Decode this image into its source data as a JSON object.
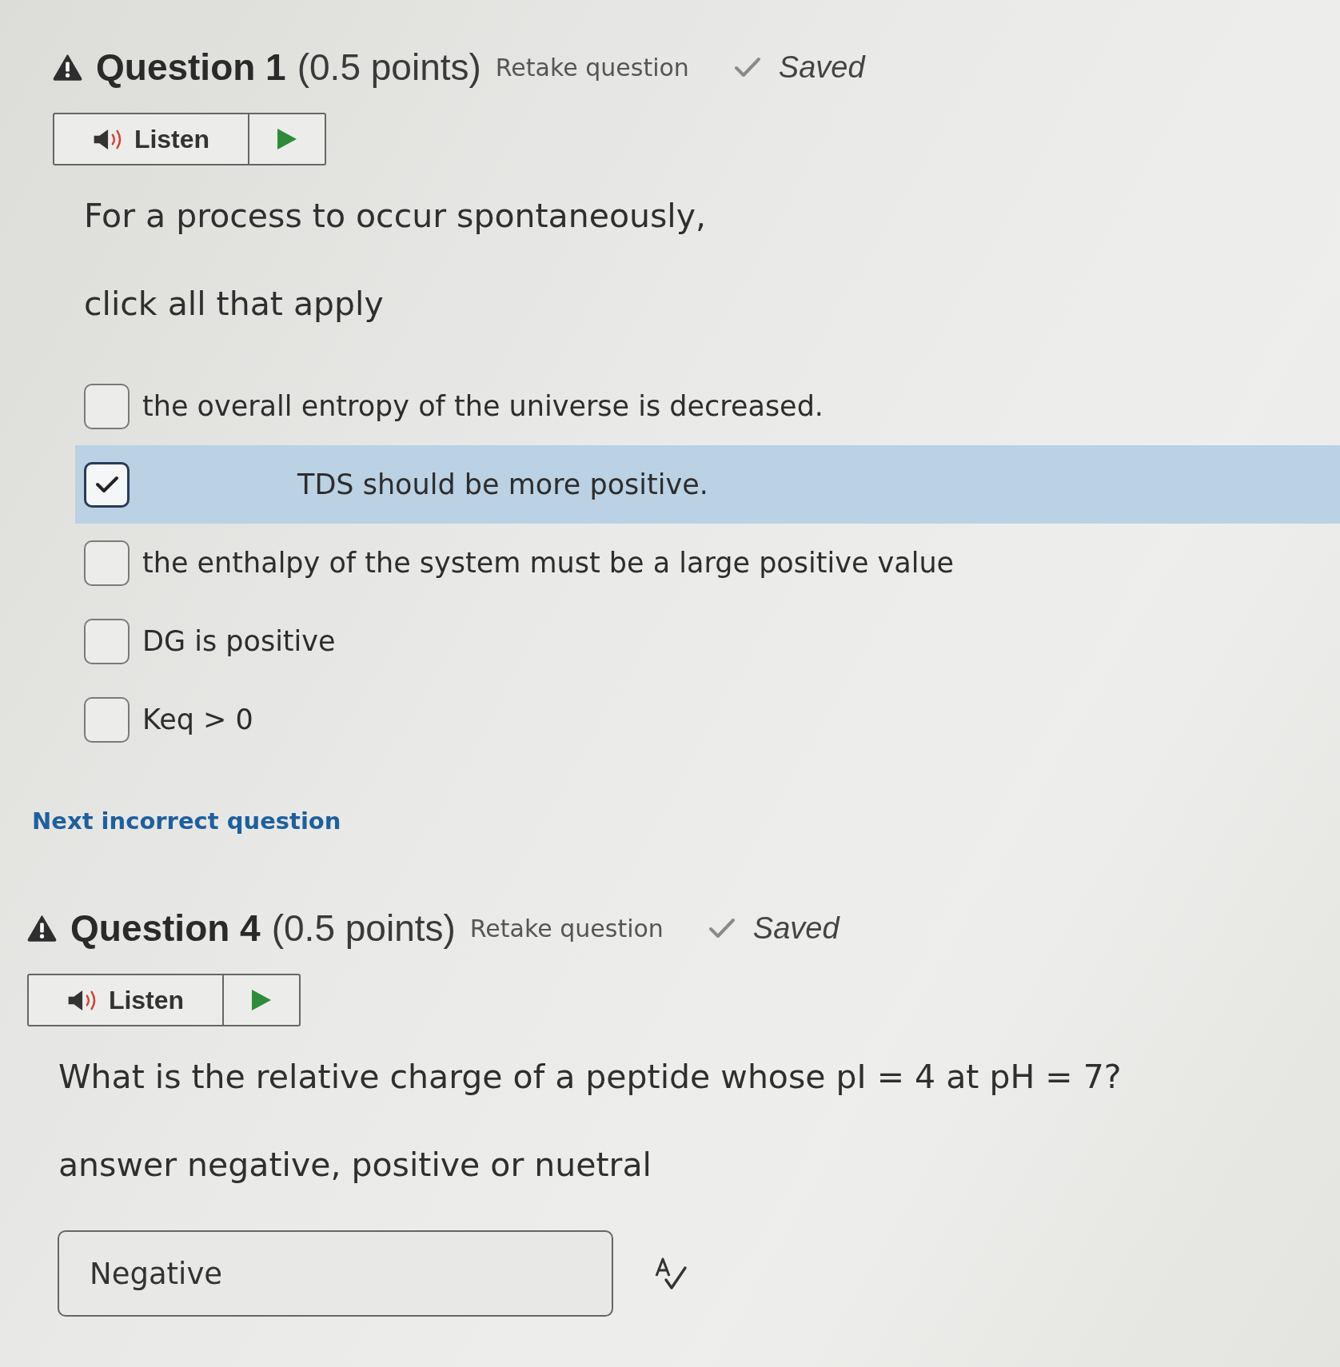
{
  "sections": [
    {
      "kind": "multi_select",
      "title": "Question 1",
      "points": "(0.5 points)",
      "retake": "Retake question",
      "status": "Saved",
      "listen": "Listen",
      "prompt": [
        "For a process to occur spontaneously,",
        "click all that apply"
      ],
      "options": [
        {
          "label": "the overall entropy of the universe is decreased.",
          "checked": false,
          "highlighted": false
        },
        {
          "label": "TDS should be more positive.",
          "checked": true,
          "highlighted": true
        },
        {
          "label": "the enthalpy of the system must be a large positive value",
          "checked": false,
          "highlighted": false
        },
        {
          "label": "DG is positive",
          "checked": false,
          "highlighted": false
        },
        {
          "label": "Keq > 0",
          "checked": false,
          "highlighted": false
        }
      ]
    },
    {
      "kind": "link",
      "label": "Next incorrect question"
    },
    {
      "kind": "text_answer",
      "title": "Question 4",
      "points": "(0.5 points)",
      "retake": "Retake question",
      "status": "Saved",
      "listen": "Listen",
      "prompt": [
        "What is the relative charge of a peptide whose pI = 4 at pH = 7?",
        "answer negative, positive or nuetral"
      ],
      "answer": {
        "value": "Negative"
      }
    }
  ]
}
